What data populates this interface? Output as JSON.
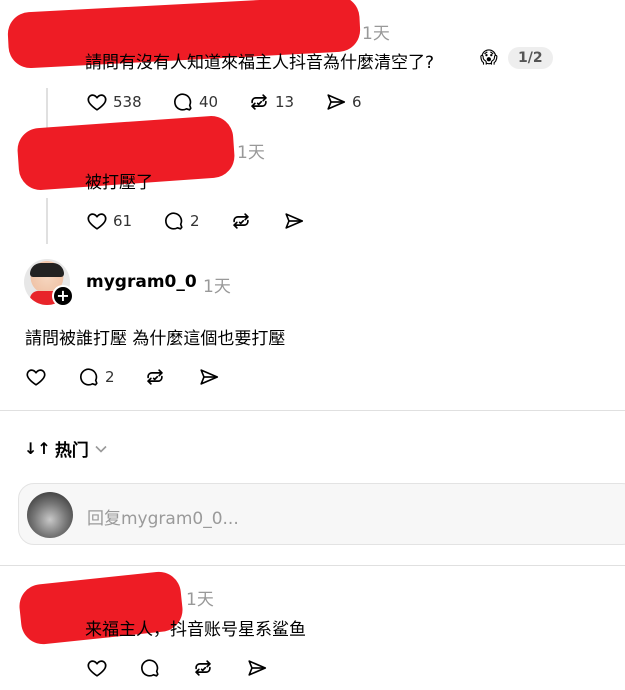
{
  "comments": [
    {
      "time": "1天",
      "text": "請問有沒有人知道來福主人抖音為什麼清空了?",
      "emoji": "😱",
      "page_badge": "1/2",
      "likes": "538",
      "replies": "40",
      "reposts": "13",
      "shares": "6"
    },
    {
      "time": "1天",
      "text": "被打壓了",
      "likes": "61",
      "replies": "2"
    },
    {
      "username": "mygram0_0",
      "time": "1天",
      "text": "請問被誰打壓 為什麼這個也要打壓",
      "replies": "2"
    }
  ],
  "sort": {
    "arrows": "↓↑",
    "label": "热门"
  },
  "reply": {
    "placeholder": "回复mygram0_0..."
  },
  "bottom_comment": {
    "time": "1天",
    "text": "来福主人，抖音账号星系鲨鱼"
  },
  "colors": {
    "redaction": "#ee1c25",
    "muted": "#999999",
    "divider": "#e0e0e0"
  },
  "icons": [
    "heart-icon",
    "comment-icon",
    "repost-icon",
    "send-icon",
    "plus-icon",
    "chevron-down-icon",
    "sort-icon"
  ]
}
